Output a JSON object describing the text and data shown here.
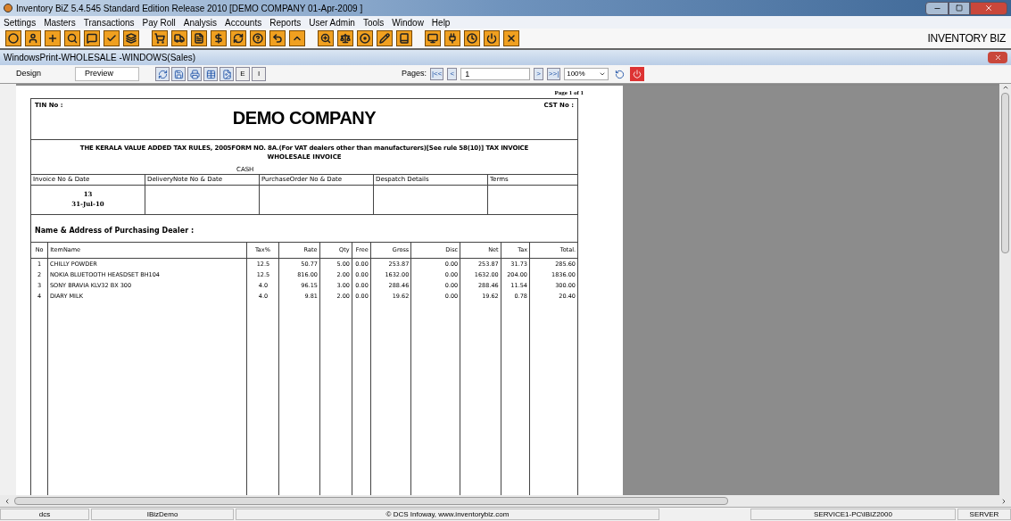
{
  "window": {
    "title": "Inventory BiZ 5.4.545 Standard Edition Release 2010  [DEMO COMPANY 01-Apr-2009 ]"
  },
  "menu": [
    "Settings",
    "Masters",
    "Transactions",
    "Pay Roll",
    "Analysis",
    "Accounts",
    "Reports",
    "User Admin",
    "Tools",
    "Window",
    "Help"
  ],
  "brand": "INVENTORY BIZ",
  "child_window": {
    "title": "WindowsPrint-WHOLESALE -WINDOWS(Sales)"
  },
  "view_tabs": [
    {
      "label": "Design",
      "selected": false
    },
    {
      "label": "Preview",
      "selected": true
    }
  ],
  "print_toolbar": {
    "text_buttons": [
      "E",
      "I"
    ],
    "pages_label": "Pages:",
    "first": "|<<",
    "prev": "<",
    "page": "1",
    "next": ">",
    "last": ">>|",
    "zoom": "100%"
  },
  "invoice": {
    "page_label": "Page 1 of 1",
    "tin": "TIN No :",
    "company": "DEMO COMPANY",
    "cst": "CST No :",
    "rule": "THE KERALA VALUE ADDED TAX RULES, 2005FORM NO. 8A.(For VAT dealers other than manufacturers)[See rule 58(10)] TAX INVOICE",
    "invoice_type": "WHOLESALE INVOICE",
    "payment": "CASH",
    "header_fields": [
      {
        "label": "Invoice No & Date",
        "lines": [
          "13",
          "31-Jul-10"
        ]
      },
      {
        "label": "DeliveryNote No & Date"
      },
      {
        "label": "PurchaseOrder No & Date"
      },
      {
        "label": "Despatch Details"
      },
      {
        "label": "Terms"
      }
    ],
    "dealer_label": "Name & Address of Purchasing Dealer :",
    "columns": [
      "No",
      "ItemName",
      "Tax%",
      "Rate",
      "Qty",
      "Free",
      "Gross",
      "Disc",
      "Net",
      "Tax",
      "Total."
    ],
    "rows": [
      [
        "1",
        "CHILLY POWDER",
        "12.5",
        "50.77",
        "5.00",
        "0.00",
        "253.87",
        "0.00",
        "253.87",
        "31.73",
        "285.60"
      ],
      [
        "2",
        "NOKIA BLUETOOTH HEASDSET BH104",
        "12.5",
        "816.00",
        "2.00",
        "0.00",
        "1632.00",
        "0.00",
        "1632.00",
        "204.00",
        "1836.00"
      ],
      [
        "3",
        "SONY BRAVIA KLV32 BX 300",
        "4.0",
        "96.15",
        "3.00",
        "0.00",
        "288.46",
        "0.00",
        "288.46",
        "11.54",
        "300.00"
      ],
      [
        "4",
        "DIARY MILK",
        "4.0",
        "9.81",
        "2.00",
        "0.00",
        "19.62",
        "0.00",
        "19.62",
        "0.78",
        "20.40"
      ]
    ]
  },
  "status_bar": [
    "dcs",
    "IBizDemo",
    "© DCS Infoway, www.inventorybiz.com",
    "SERVICE1-PC\\IBIZ2000",
    "SERVER"
  ]
}
